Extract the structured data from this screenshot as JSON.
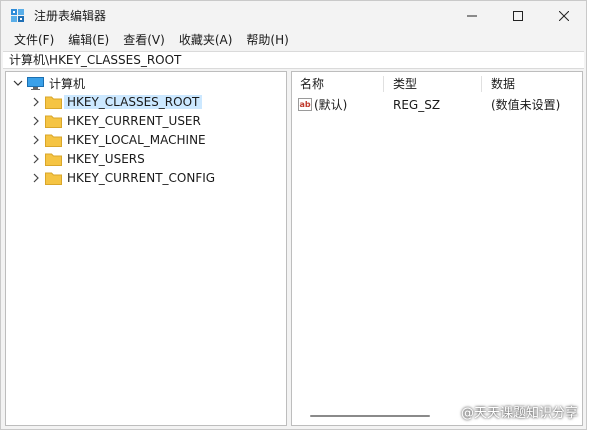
{
  "window": {
    "title": "注册表编辑器",
    "icon": "regedit-icon"
  },
  "menubar": {
    "items": [
      {
        "label": "文件(F)"
      },
      {
        "label": "编辑(E)"
      },
      {
        "label": "查看(V)"
      },
      {
        "label": "收藏夹(A)"
      },
      {
        "label": "帮助(H)"
      }
    ]
  },
  "address": {
    "path": "计算机\\HKEY_CLASSES_ROOT"
  },
  "tree": {
    "root": {
      "label": "计算机",
      "icon": "computer-icon",
      "expanded": true
    },
    "items": [
      {
        "label": "HKEY_CLASSES_ROOT",
        "icon": "folder-icon",
        "selected": true
      },
      {
        "label": "HKEY_CURRENT_USER",
        "icon": "folder-icon",
        "selected": false
      },
      {
        "label": "HKEY_LOCAL_MACHINE",
        "icon": "folder-icon",
        "selected": false
      },
      {
        "label": "HKEY_USERS",
        "icon": "folder-icon",
        "selected": false
      },
      {
        "label": "HKEY_CURRENT_CONFIG",
        "icon": "folder-icon",
        "selected": false
      }
    ]
  },
  "list": {
    "columns": {
      "name": "名称",
      "type": "类型",
      "data": "数据"
    },
    "rows": [
      {
        "name": "(默认)",
        "type": "REG_SZ",
        "data": "(数值未设置)",
        "icon": "string-value-icon"
      }
    ]
  },
  "watermark": {
    "text": "@天天课题知识分享"
  },
  "colors": {
    "selection": "#cce8ff",
    "folder": "#f5c443",
    "window_bg": "#f3f3f3"
  }
}
